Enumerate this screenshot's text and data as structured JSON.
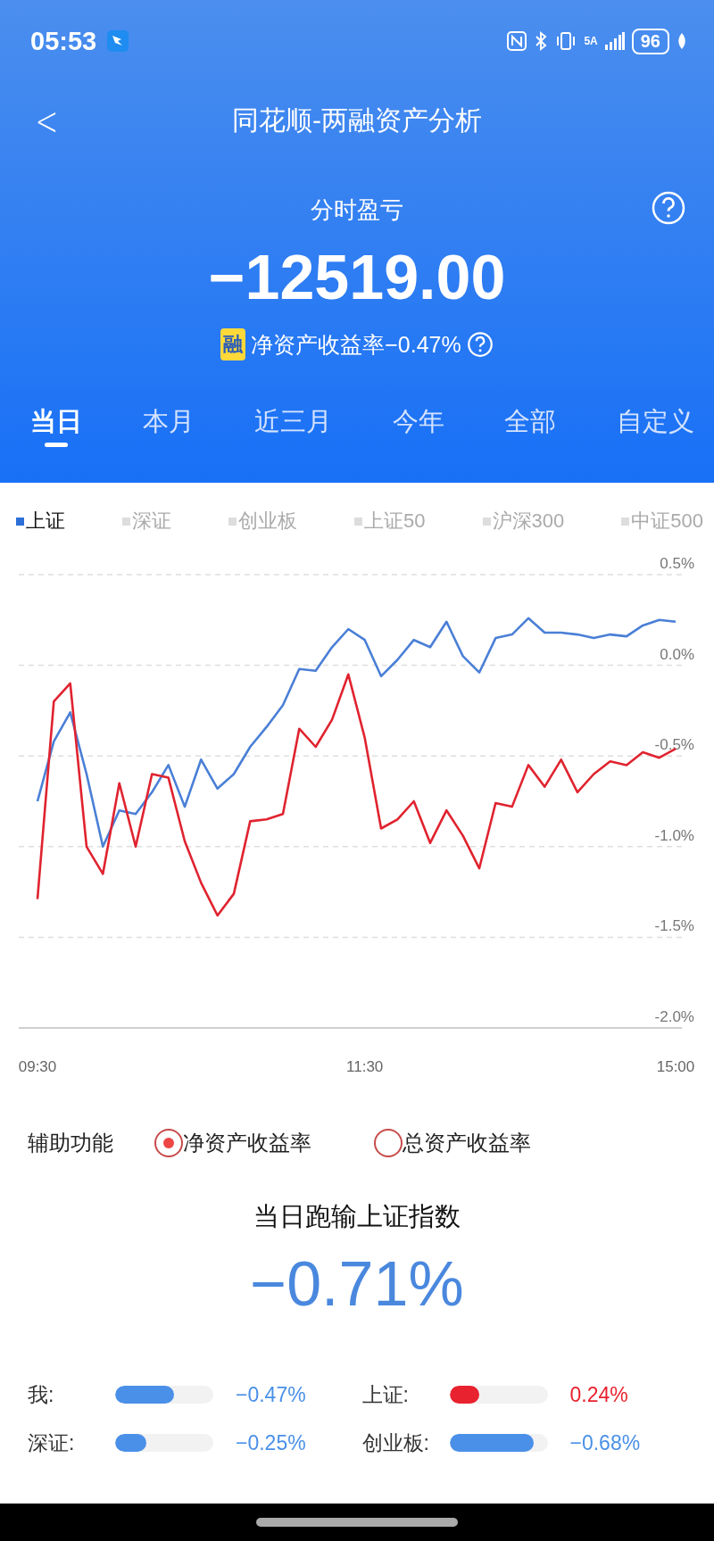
{
  "status_bar": {
    "time": "05:53",
    "network": "5A",
    "battery": "96"
  },
  "header": {
    "title": "同花顺-两融资产分析",
    "back": "<"
  },
  "summary": {
    "label": "分时盈亏",
    "amount": "−12519.00",
    "badge": "融",
    "roe": "净资产收益率−0.47%"
  },
  "tabs": [
    {
      "label": "当日",
      "selected": true
    },
    {
      "label": "本月",
      "selected": false
    },
    {
      "label": "近三月",
      "selected": false
    },
    {
      "label": "今年",
      "selected": false
    },
    {
      "label": "全部",
      "selected": false
    },
    {
      "label": "自定义",
      "selected": false
    }
  ],
  "indices": [
    {
      "label": "上证",
      "selected": true
    },
    {
      "label": "深证",
      "selected": false
    },
    {
      "label": "创业板",
      "selected": false
    },
    {
      "label": "上证50",
      "selected": false
    },
    {
      "label": "沪深300",
      "selected": false
    },
    {
      "label": "中证500",
      "selected": false
    }
  ],
  "chart_data": {
    "type": "line",
    "categories": [
      "09:30",
      null,
      null,
      null,
      null,
      null,
      null,
      null,
      null,
      null,
      null,
      null,
      null,
      null,
      null,
      null,
      null,
      null,
      null,
      null,
      "11:30",
      null,
      null,
      null,
      null,
      null,
      null,
      null,
      null,
      null,
      null,
      null,
      null,
      null,
      null,
      null,
      null,
      null,
      null,
      "15:00"
    ],
    "ylim": [
      -2.0,
      0.5
    ],
    "grid": true,
    "yticks": [
      {
        "value": 0.5,
        "label": "0.5%"
      },
      {
        "value": 0,
        "label": "0.0%"
      },
      {
        "value": -0.5,
        "label": "-0.5%"
      },
      {
        "value": -1.0,
        "label": "-1.0%"
      },
      {
        "value": -1.5,
        "label": "-1.5%"
      },
      {
        "value": -2.0,
        "label": "-2.0%"
      }
    ],
    "series": [
      {
        "color": "#4a7fd6",
        "values": [
          -0.75,
          -0.42,
          -0.26,
          -0.6,
          -1.0,
          -0.8,
          -0.82,
          -0.7,
          -0.55,
          -0.78,
          -0.52,
          -0.68,
          -0.6,
          -0.45,
          -0.34,
          -0.22,
          -0.02,
          -0.03,
          0.1,
          0.2,
          0.14,
          -0.06,
          0.03,
          0.14,
          0.1,
          0.24,
          0.05,
          -0.04,
          0.15,
          0.17,
          0.26,
          0.18,
          0.18,
          0.17,
          0.15,
          0.17,
          0.16,
          0.22,
          0.25,
          0.24
        ]
      },
      {
        "color": "#e0232f",
        "values": [
          -1.29,
          -0.2,
          -0.1,
          -1.0,
          -1.15,
          -0.65,
          -1.0,
          -0.6,
          -0.62,
          -0.97,
          -1.2,
          -1.38,
          -1.26,
          -0.86,
          -0.85,
          -0.82,
          -0.35,
          -0.45,
          -0.3,
          -0.05,
          -0.4,
          -0.9,
          -0.85,
          -0.75,
          -0.98,
          -0.8,
          -0.94,
          -1.12,
          -0.76,
          -0.78,
          -0.55,
          -0.67,
          -0.52,
          -0.7,
          -0.6,
          -0.53,
          -0.55,
          -0.48,
          -0.51,
          -0.46
        ]
      }
    ]
  },
  "assist": {
    "label": "辅助功能",
    "options": [
      {
        "label": "净资产收益率",
        "selected": true
      },
      {
        "label": "总资产收益率",
        "selected": false
      }
    ]
  },
  "compare": {
    "title": "当日跑输上证指数",
    "value": "−0.71%"
  },
  "bars": [
    {
      "label": "我:",
      "level": 0.6,
      "color": "#4a90e8",
      "reading": "−0.47%"
    },
    {
      "label": "上证:",
      "level": 0.3,
      "color": "#e8222e",
      "reading": "0.24%"
    },
    {
      "label": "深证:",
      "level": 0.32,
      "color": "#4a90e8",
      "reading": "−0.25%"
    },
    {
      "label": "创业板:",
      "level": 0.86,
      "color": "#4a90e8",
      "reading": "−0.68%"
    }
  ]
}
